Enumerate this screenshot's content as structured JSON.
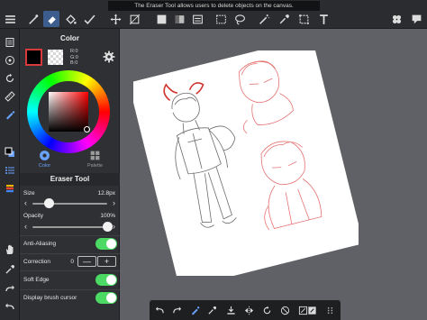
{
  "app": {
    "tooltip": "The Eraser Tool allows users to delete objects on the canvas.",
    "accent_color": "#3c5d8e",
    "toggle_color": "#4cd964",
    "brush_color": "#000000"
  },
  "top_toolbar": {
    "left_tools": [
      "menu-icon",
      "brush-icon",
      "eraser-icon",
      "fill-icon",
      "select-icon"
    ],
    "center_tools": [
      "move-icon",
      "transform-icon",
      "crop-icon",
      "fill-square-icon",
      "gradient-icon",
      "layer-fill-icon",
      "selection-rect-icon",
      "lasso-icon",
      "magic-wand-icon",
      "eyedropper-icon",
      "text-icon"
    ],
    "right_tools": [
      "layers-icon",
      "settings-icon"
    ],
    "selected_tool": "eraser-icon"
  },
  "color_panel": {
    "title": "Color",
    "rgb": {
      "r": "R:0",
      "g": "G:0",
      "b": "B:0"
    },
    "tabs": [
      {
        "label": "Color",
        "icon": "color-wheel-icon",
        "active": true
      },
      {
        "label": "Palette",
        "icon": "palette-icon",
        "active": false
      }
    ]
  },
  "eraser_panel": {
    "title": "Eraser Tool",
    "size_label": "Size",
    "size_value": "12.8px",
    "size_fraction": 0.22,
    "opacity_label": "Opacity",
    "opacity_value": "100%",
    "opacity_fraction": 1.0,
    "anti_aliasing_label": "Anti-Aliasing",
    "anti_aliasing_on": true,
    "correction_label": "Correction",
    "correction_value": "0",
    "correction_minus": "—",
    "correction_plus": "+",
    "soft_edge_label": "Soft Edge",
    "soft_edge_on": true,
    "display_cursor_label": "Display brush cursor",
    "display_cursor_on": true
  },
  "left_rail": {
    "tools": [
      "layers-list-icon",
      "navigator-icon",
      "rotate-icon",
      "ruler-icon",
      "pen-icon",
      "color-swatch-icon",
      "list-icon",
      "layer-stack-icon",
      "hand-icon",
      "eyedropper-icon",
      "undo-icon",
      "redo-icon"
    ]
  },
  "bottom_toolbar": {
    "tools": [
      "undo-icon",
      "redo-icon",
      "brush-icon",
      "eyedropper-icon",
      "save-icon",
      "flip-icon",
      "rotate-icon",
      "no-transform-icon",
      "reset-icon",
      "fullscreen-icon",
      "more-icon"
    ]
  }
}
